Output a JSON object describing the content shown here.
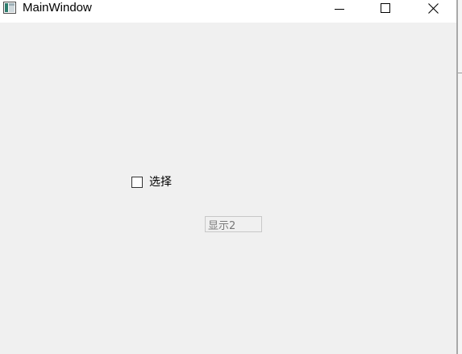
{
  "window": {
    "title": "MainWindow",
    "icon": "app-window-icon"
  },
  "title_buttons": {
    "minimize_icon": "minimize-icon",
    "maximize_icon": "maximize-icon",
    "close_icon": "close-icon"
  },
  "content": {
    "checkbox": {
      "label": "选择",
      "checked": false
    },
    "line_edit": {
      "value": "显示2",
      "enabled": false
    }
  }
}
